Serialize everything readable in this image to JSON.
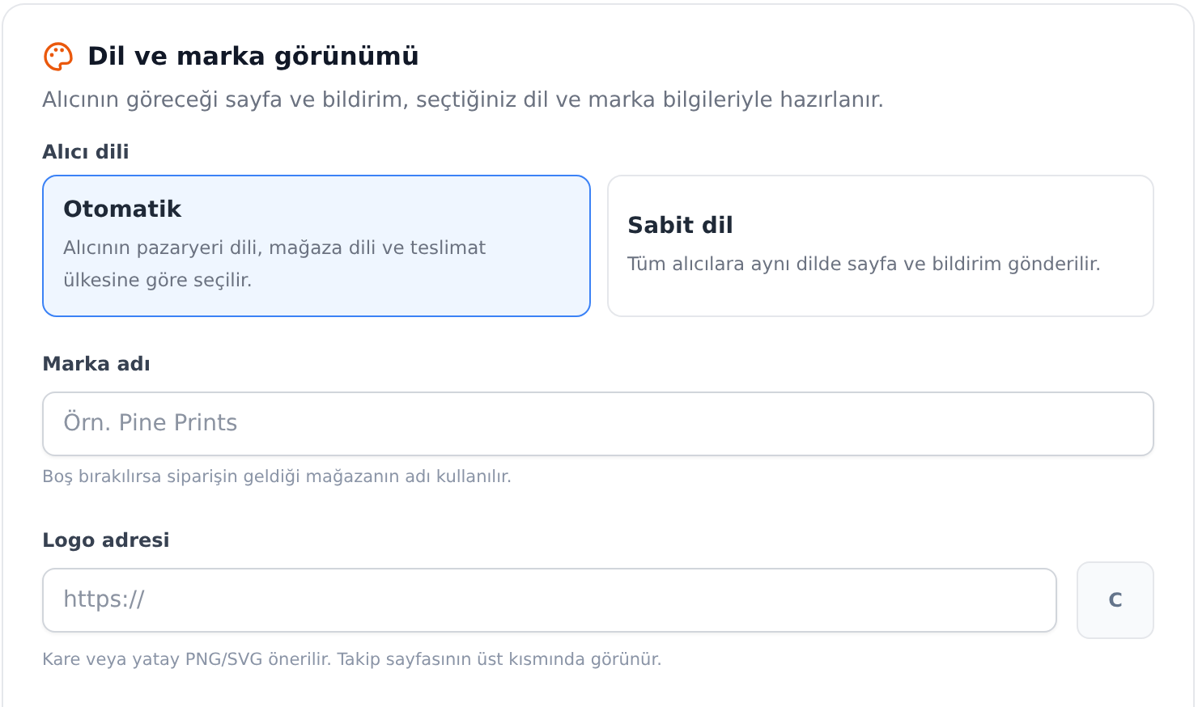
{
  "title": "Dil ve marka görünümü",
  "description": "Alıcının göreceği sayfa ve bildirim, seçtiğiniz dil ve marka bilgileriyle hazırlanır.",
  "language": {
    "label": "Alıcı dili",
    "options": [
      {
        "title": "Otomatik",
        "description": "Alıcının pazaryeri dili, mağaza dili ve teslimat ülkesine göre seçilir.",
        "selected": true
      },
      {
        "title": "Sabit dil",
        "description": "Tüm alıcılara aynı dilde sayfa ve bildirim gönderilir.",
        "selected": false
      }
    ]
  },
  "brand_name": {
    "label": "Marka adı",
    "placeholder": "Örn. Pine Prints",
    "help": "Boş bırakılırsa siparişin geldiği mağazanın adı kullanılır."
  },
  "logo_url": {
    "label": "Logo adresi",
    "placeholder": "https://",
    "preview": "C",
    "help": "Kare veya yatay PNG/SVG önerilir. Takip sayfasının üst kısmında görünür."
  }
}
